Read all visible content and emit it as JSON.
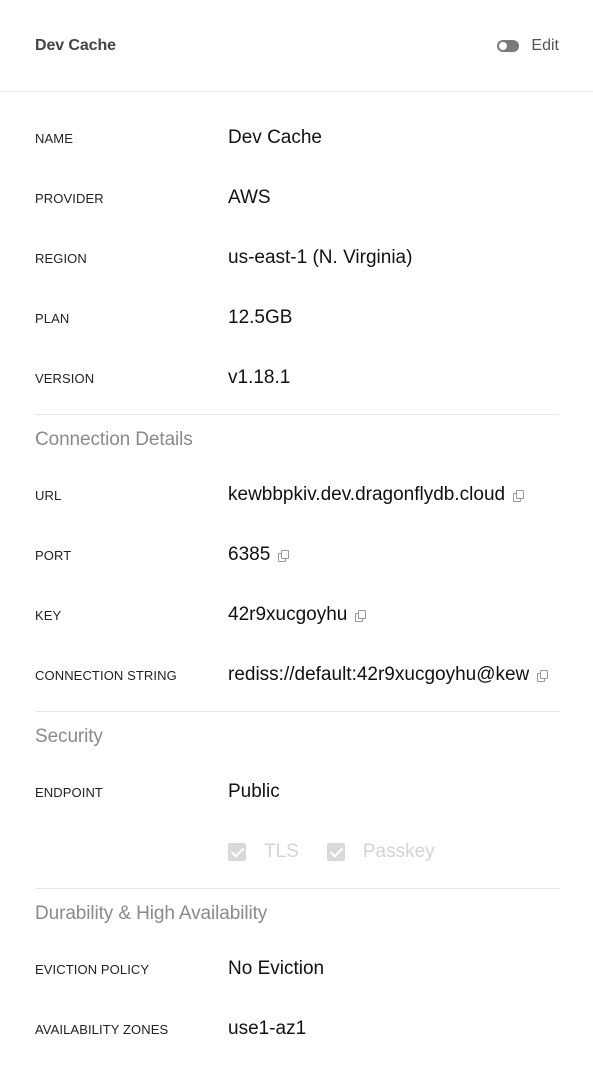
{
  "header": {
    "title": "Dev Cache",
    "toggle_on": false,
    "edit_label": "Edit"
  },
  "general": [
    {
      "label": "NAME",
      "value": "Dev Cache"
    },
    {
      "label": "PROVIDER",
      "value": "AWS"
    },
    {
      "label": "REGION",
      "value": "us-east-1 (N. Virginia)"
    },
    {
      "label": "PLAN",
      "value": "12.5GB"
    },
    {
      "label": "VERSION",
      "value": "v1.18.1"
    }
  ],
  "connection": {
    "title": "Connection Details",
    "rows": [
      {
        "label": "URL",
        "value": "kewbbpkiv.dev.dragonflydb.cloud"
      },
      {
        "label": "PORT",
        "value": "6385"
      },
      {
        "label": "KEY",
        "value": "42r9xucgoyhu"
      },
      {
        "label": "CONNECTION STRING",
        "value": "rediss://default:42r9xucgoyhu@kew"
      }
    ]
  },
  "security": {
    "title": "Security",
    "endpoint_label": "ENDPOINT",
    "endpoint_value": "Public",
    "tls_label": "TLS",
    "passkey_label": "Passkey"
  },
  "durability": {
    "title": "Durability & High Availability",
    "rows": [
      {
        "label": "EVICTION POLICY",
        "value": "No Eviction"
      },
      {
        "label": "AVAILABILITY ZONES",
        "value": "use1-az1"
      }
    ]
  },
  "icons": {
    "copy": "copy-icon",
    "toggle": "toggle-icon",
    "check": "checkbox-checked-icon"
  },
  "colors": {
    "section_title": "#8a8a8a",
    "disabled_check": "#d9d9d9",
    "toggle_off": "#7a7a7a"
  }
}
